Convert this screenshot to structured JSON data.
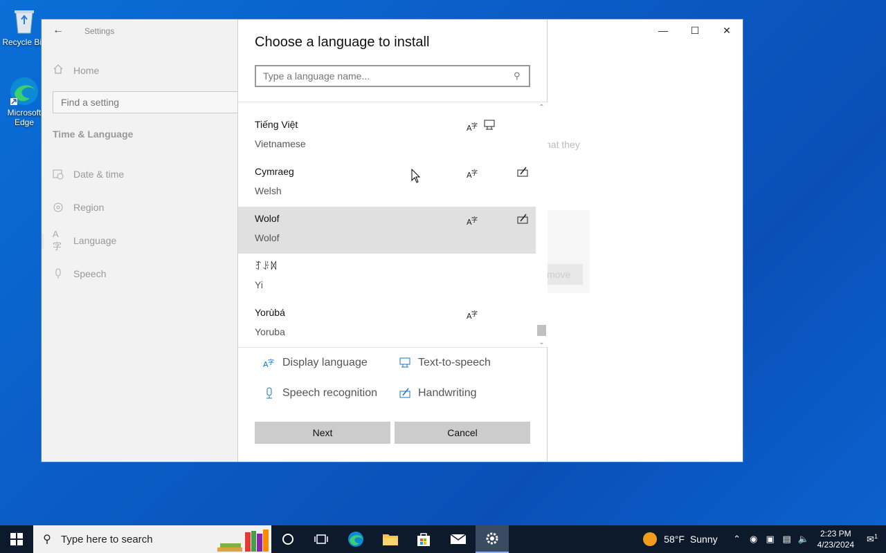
{
  "desktop": {
    "icons": [
      {
        "label": "Recycle Bin"
      },
      {
        "label": "Microsoft Edge"
      }
    ]
  },
  "settings": {
    "title": "Settings",
    "home": "Home",
    "find_placeholder": "Find a setting",
    "section": "Time & Language",
    "nav": [
      "Date & time",
      "Region",
      "Language",
      "Speech"
    ],
    "bg_text": "hat they",
    "bg_button": "move"
  },
  "dialog": {
    "title": "Choose a language to install",
    "search_placeholder": "Type a language name...",
    "languages": [
      {
        "native": "Tiếng Việt",
        "english": "Vietnamese",
        "features": [
          "display-language",
          "text-to-speech"
        ],
        "selected": false
      },
      {
        "native": "Cymraeg",
        "english": "Welsh",
        "features": [
          "display-language",
          "handwriting"
        ],
        "selected": false
      },
      {
        "native": "Wolof",
        "english": "Wolof",
        "features": [
          "display-language",
          "handwriting"
        ],
        "selected": true
      },
      {
        "native": "ꆈꌠꉙ",
        "english": "Yi",
        "features": [],
        "selected": false
      },
      {
        "native": "Yorùbá",
        "english": "Yoruba",
        "features": [
          "display-language"
        ],
        "selected": false
      }
    ],
    "legend": {
      "display_language": "Display language",
      "text_to_speech": "Text-to-speech",
      "speech_recognition": "Speech recognition",
      "handwriting": "Handwriting"
    },
    "next_label": "Next",
    "cancel_label": "Cancel"
  },
  "taskbar": {
    "search_placeholder": "Type here to search",
    "weather": {
      "temp": "58°F",
      "condition": "Sunny"
    },
    "time": "2:23 PM",
    "date": "4/23/2024",
    "notification_count": "1"
  },
  "colors": {
    "accent": "#0078d7",
    "selected_row": "#e0e0e0",
    "taskbar": "#0c1a2c"
  }
}
